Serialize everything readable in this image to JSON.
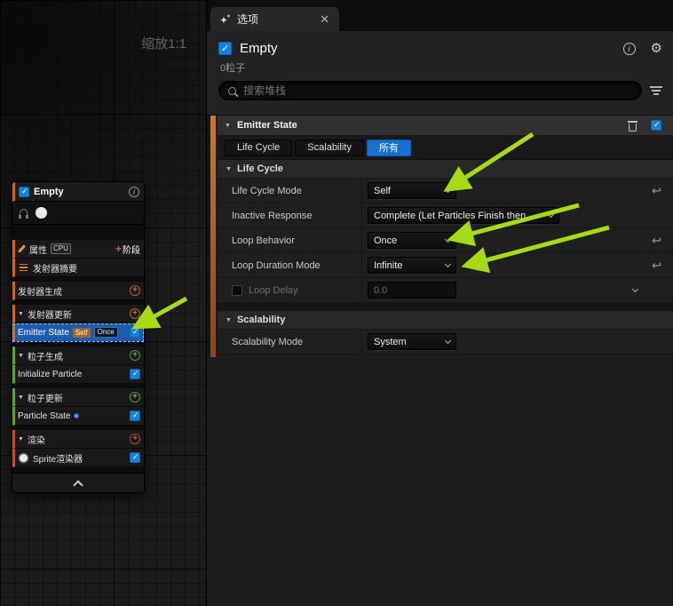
{
  "graph": {
    "zoom_label": "缩放1:1"
  },
  "node_panel": {
    "title": "Empty",
    "prop_row": {
      "label": "属性",
      "cpu_badge": "CPU",
      "stage_button": "阶段"
    },
    "rows": {
      "summary": "发射器摘要",
      "emitter_spawn": "发射器生成",
      "emitter_update": "发射器更新",
      "emitter_state": {
        "label": "Emitter State",
        "badges": [
          "Self",
          "Once"
        ]
      },
      "particle_spawn": "粒子生成",
      "initialize_particle": "Initialize Particle",
      "particle_update": "粒子更新",
      "particle_state": "Particle State",
      "render": "渲染",
      "sprite_renderer": "Sprite渲染器"
    }
  },
  "panel": {
    "tab_label": "选项",
    "title": "Empty",
    "particle_count": "0粒子",
    "search_placeholder": "搜索堆栈"
  },
  "details": {
    "section_title": "Emitter State",
    "filter_tabs": {
      "life_cycle": "Life Cycle",
      "scalability": "Scalability",
      "all": "所有"
    },
    "life_cycle": {
      "header": "Life Cycle",
      "rows": [
        {
          "label": "Life Cycle Mode",
          "value": "Self"
        },
        {
          "label": "Inactive Response",
          "value": "Complete (Let Particles Finish then"
        },
        {
          "label": "Loop Behavior",
          "value": "Once"
        },
        {
          "label": "Loop Duration Mode",
          "value": "Infinite"
        },
        {
          "label": "Loop Delay",
          "value": "0.0"
        }
      ]
    },
    "scalability": {
      "header": "Scalability",
      "rows": [
        {
          "label": "Scalability Mode",
          "value": "System"
        }
      ]
    }
  },
  "colors": {
    "accent_blue": "#1770cf",
    "emitter_orange": "#c7792d",
    "arrow_green": "#a6d916",
    "checkbox_blue": "#1583dc"
  }
}
